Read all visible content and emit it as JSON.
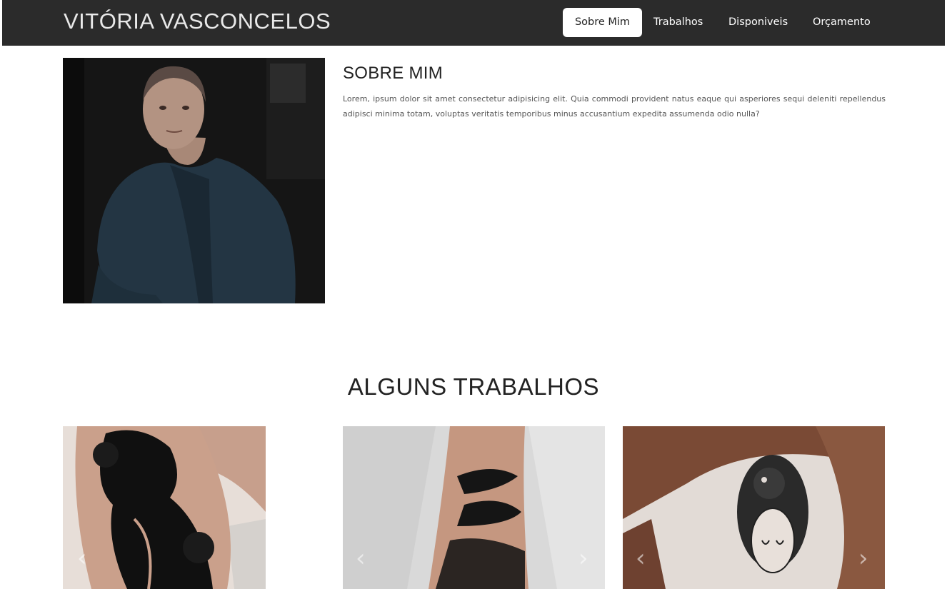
{
  "brand": "VITÓRIA VASCONCELOS",
  "nav": {
    "items": [
      "Sobre Mim",
      "Trabalhos",
      "Disponiveis",
      "Orçamento"
    ],
    "active": "Sobre Mim"
  },
  "about": {
    "title": "SOBRE MIM",
    "text": "Lorem, ipsum dolor sit amet consectetur adipisicing elit. Quia commodi provident natus eaque qui asperiores sequi deleniti repellendus adipisci minima totam, voluptas veritatis temporibus minus accusantium expedita assumenda odio nulla?"
  },
  "works": {
    "title": "ALGUNS TRABALHOS",
    "prev_icon": "‹",
    "next_icon": "›"
  }
}
